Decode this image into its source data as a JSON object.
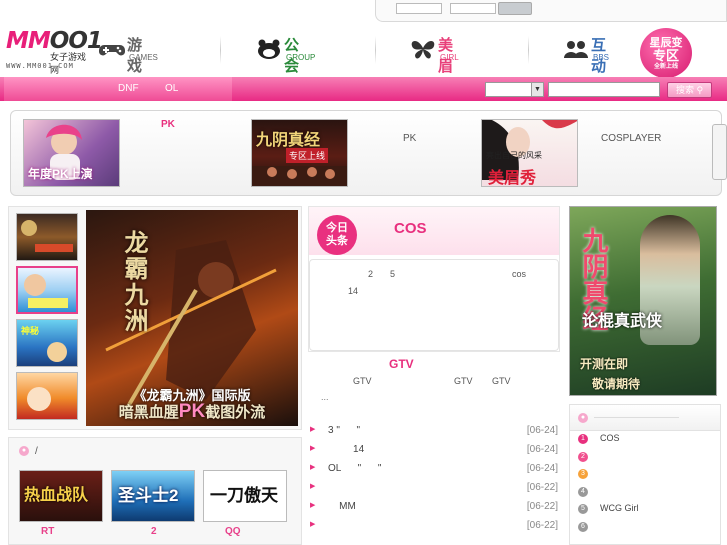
{
  "header": {
    "logo_text": "MM",
    "logo_suffix": "OO1",
    "logo_sub": "女子游戏网",
    "logo_url": "WWW.MM001.COM",
    "nav": [
      {
        "zh": "游戏",
        "en": "GAMES",
        "icon": "gamepad-icon"
      },
      {
        "zh": "公会",
        "en": "GROUP",
        "icon": "guild-icon"
      },
      {
        "zh": "美眉",
        "en": "GIRL",
        "icon": "butterfly-icon"
      },
      {
        "zh": "互动",
        "en": "BBS",
        "icon": "people-icon"
      }
    ],
    "special": {
      "l1": "星辰变",
      "l2": "专区",
      "l3": "全新上线"
    }
  },
  "pinkbar": {
    "link1": "DNF",
    "link2": "OL",
    "search_button": "搜索"
  },
  "featured": {
    "label1": "PK",
    "label2": "PK",
    "label3": "COSPLAYER",
    "thumb1_text": "年度PK上演",
    "thumb2_text": "九阴真经",
    "thumb2_sub": "专区上线",
    "thumb3_top": "亮出自己的风采",
    "thumb3_text": "美眉秀"
  },
  "leftcol": {
    "banner_title": "龙霸九洲",
    "banner_caption": "《龙霸九洲》国际版",
    "banner_caption2_a": "暗黑血腥",
    "banner_caption2_pk": "PK",
    "banner_caption2_b": "截图外流",
    "section2_head": "/",
    "games": [
      {
        "label": "RT",
        "img": "热血战队"
      },
      {
        "label": "2",
        "img": "圣斗士2"
      },
      {
        "label": "QQ",
        "img": "一刀傲天"
      }
    ]
  },
  "middle": {
    "today_badge_1": "今日",
    "today_badge_2": "头条",
    "headline": "COS",
    "hb_t1": "2",
    "hb_t2": "5",
    "hb_t3": "cos",
    "hb_t4": "14",
    "gtv_title": "GTV",
    "gtv_tags": [
      "GTV",
      "GTV",
      "GTV"
    ],
    "dots": "...",
    "news": [
      {
        "text": "3 \"      \"",
        "date": "[06-24]"
      },
      {
        "text": "         14",
        "date": "[06-24]"
      },
      {
        "text": "OL      \"      \"",
        "date": "[06-24]"
      },
      {
        "text": "",
        "date": "[06-22]"
      },
      {
        "text": "    MM",
        "date": "[06-22]"
      },
      {
        "text": "",
        "date": "[06-22]"
      }
    ]
  },
  "right": {
    "banner_title": "九阴真经",
    "banner_sub": "论棍真武侠",
    "banner_l1": "开测在即",
    "banner_l2": "敬请期待",
    "rank": [
      {
        "n": "1",
        "text": "COS",
        "color": "#e8307e"
      },
      {
        "n": "2",
        "text": "",
        "color": "#f0508e"
      },
      {
        "n": "3",
        "text": "",
        "color": "#f6a23a"
      },
      {
        "n": "4",
        "text": "",
        "color": "#999999"
      },
      {
        "n": "5",
        "text": "WCG Girl",
        "color": "#999999"
      },
      {
        "n": "6",
        "text": "",
        "color": "#999999"
      }
    ]
  }
}
